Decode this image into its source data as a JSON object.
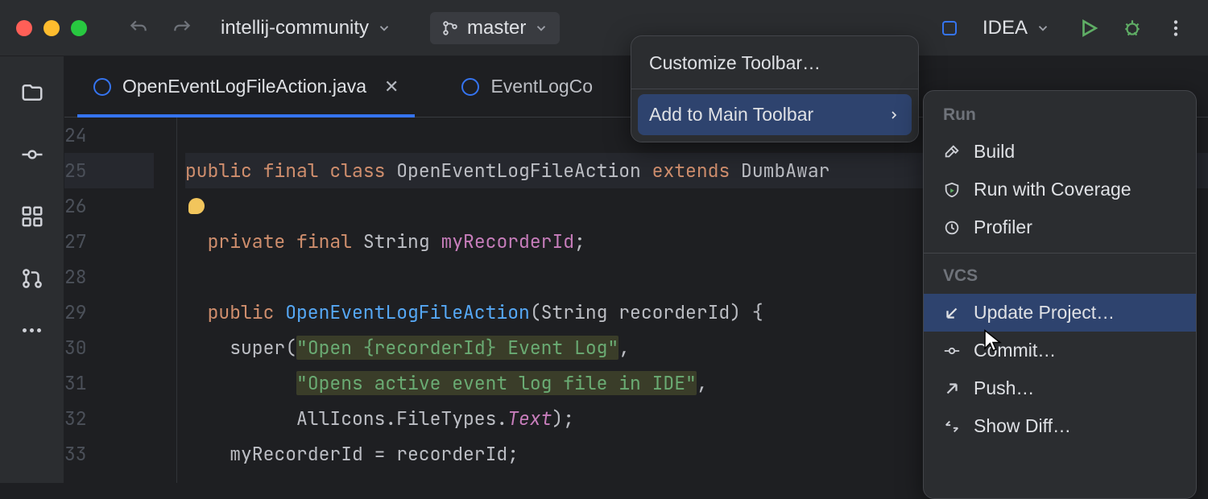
{
  "titlebar": {
    "project": "intellij-community",
    "branch": "master",
    "run_config": "IDEA"
  },
  "tabs": [
    {
      "label": "OpenEventLogFileAction.java",
      "active": true
    },
    {
      "label": "EventLogCo",
      "active": false
    }
  ],
  "gutter_lines": [
    "24",
    "25",
    "26",
    "27",
    "28",
    "29",
    "30",
    "31",
    "32",
    "33"
  ],
  "code": {
    "l24": "",
    "l25a": "public ",
    "l25b": "final ",
    "l25c": "class ",
    "l25d": "OpenEventLogFileAction ",
    "l25e": "extends ",
    "l25f": "DumbAwar",
    "l27a": "  private ",
    "l27b": "final ",
    "l27c": "String ",
    "l27d": "myRecorderId",
    "l27e": ";",
    "l29a": "  public ",
    "l29b": "OpenEventLogFileAction",
    "l29c": "(String recorderId) {",
    "l30a": "    super(",
    "l30b": "\"Open {recorderId} Event Log\"",
    "l30c": ",",
    "l31a": "          ",
    "l31b": "\"Opens active event log file in IDE\"",
    "l31c": ",",
    "l32a": "          AllIcons.FileTypes.",
    "l32b": "Text",
    "l32c": ");",
    "l33a": "    myRecorderId = recorderId;"
  },
  "context_menu": {
    "customize": "Customize Toolbar…",
    "add": "Add to Main Toolbar"
  },
  "sub_popup": {
    "sec1": "Run",
    "build": "Build",
    "coverage": "Run with Coverage",
    "profiler": "Profiler",
    "sec2": "VCS",
    "update": "Update Project…",
    "commit": "Commit…",
    "push": "Push…",
    "diff": "Show Diff…"
  }
}
